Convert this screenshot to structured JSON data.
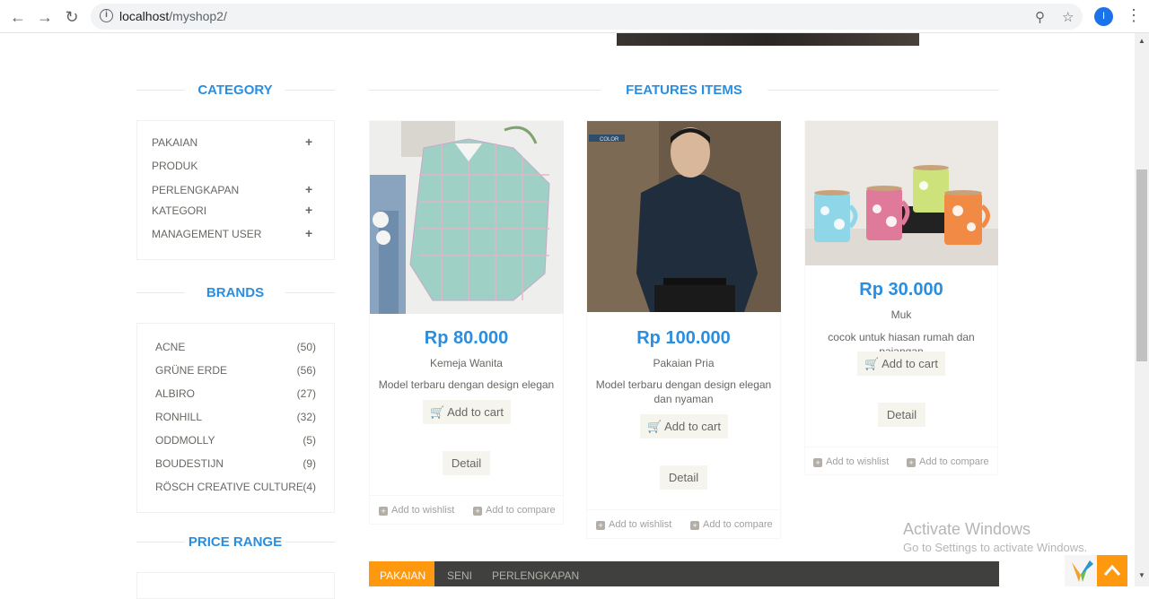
{
  "browser": {
    "url_host": "localhost",
    "url_path": "/myshop2/",
    "profile_initial": "I"
  },
  "category": {
    "title": "CATEGORY",
    "items": [
      {
        "label": "PAKAIAN",
        "expandable": true
      },
      {
        "label": "PRODUK",
        "expandable": false
      },
      {
        "label": "PERLENGKAPAN",
        "expandable": true
      },
      {
        "label": "KATEGORI",
        "expandable": true
      },
      {
        "label": "MANAGEMENT USER",
        "expandable": true
      }
    ]
  },
  "brands": {
    "title": "BRANDS",
    "items": [
      {
        "name": "ACNE",
        "count": "(50)"
      },
      {
        "name": "GRÜNE ERDE",
        "count": "(56)"
      },
      {
        "name": "ALBIRO",
        "count": "(27)"
      },
      {
        "name": "RONHILL",
        "count": "(32)"
      },
      {
        "name": "ODDMOLLY",
        "count": "(5)"
      },
      {
        "name": "BOUDESTIJN",
        "count": "(9)"
      },
      {
        "name": "RÖSCH CREATIVE CULTURE",
        "count": "(4)"
      }
    ]
  },
  "price_range": {
    "title": "PRICE RANGE"
  },
  "features": {
    "title": "FEATURES ITEMS",
    "products": [
      {
        "price": "Rp 80.000",
        "name": "Kemeja Wanita",
        "desc": "Model terbaru dengan design elegan",
        "cart": "Add to cart",
        "detail": "Detail",
        "wishlist": "Add to wishlist",
        "compare": "Add to compare"
      },
      {
        "price": "Rp 100.000",
        "name": "Pakaian Pria",
        "desc": "Model terbaru dengan design elegan dan nyaman",
        "cart": "Add to cart",
        "detail": "Detail",
        "wishlist": "Add to wishlist",
        "compare": "Add to compare",
        "image_label": "COLOR"
      },
      {
        "price": "Rp 30.000",
        "name": "Muk",
        "desc": "cocok untuk hiasan rumah dan pajangan",
        "cart": "Add to cart",
        "detail": "Detail",
        "wishlist": "Add to wishlist",
        "compare": "Add to compare"
      }
    ]
  },
  "tabs": [
    "PAKAIAN",
    "SENI",
    "PERLENGKAPAN"
  ],
  "watermark": {
    "line1": "Activate Windows",
    "line2": "Go to Settings to activate Windows."
  }
}
